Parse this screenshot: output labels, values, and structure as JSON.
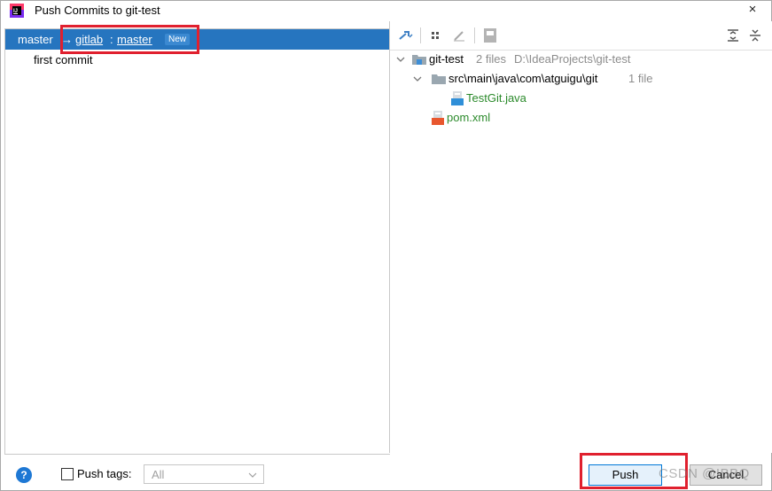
{
  "window": {
    "title": "Push Commits to git-test",
    "close_glyph": "×",
    "app_icon": "intellij-icon"
  },
  "commits_panel": {
    "branch": {
      "local": "master",
      "arrow": "→",
      "remote": "gitlab",
      "separator": ":",
      "target": "master",
      "badge": "New"
    },
    "commits": [
      "first commit"
    ]
  },
  "changes_panel": {
    "toolbar_icons": [
      "pin-arrow-icon",
      "group-by-icon",
      "edit-source-icon",
      "preview-icon",
      "expand-all-icon",
      "collapse-all-icon"
    ],
    "tree": {
      "root": {
        "name": "git-test",
        "count": "2 files",
        "path": "D:\\IdeaProjects\\git-test"
      },
      "dir": {
        "name": "src\\main\\java\\com\\atguigu\\git",
        "count": "1 file"
      },
      "files": [
        "TestGit.java",
        "pom.xml"
      ]
    }
  },
  "bottom": {
    "help_glyph": "?",
    "push_tags_label": "Push tags:",
    "tags_select_value": "All",
    "push_button": "Push",
    "cancel_button": "Cancel",
    "watermark": "CSDN @IBBQ"
  },
  "colors": {
    "selection": "#2675bf",
    "highlight_box": "#e0202e",
    "file_new": "#2b8a2b"
  }
}
